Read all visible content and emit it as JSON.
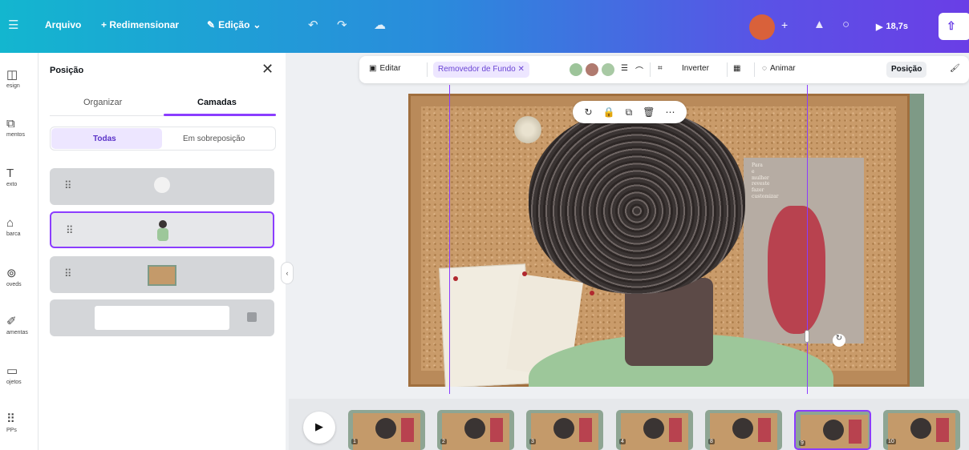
{
  "topbar": {
    "menu_icon": "hamburger-icon",
    "file_label": "Arquivo",
    "resize_label": "+ Redimensionar",
    "edit_label": "Edição",
    "undo_icon": "undo-icon",
    "redo_icon": "redo-icon",
    "cloud_icon": "cloud-save-icon",
    "time_label": "18,7s",
    "share_icon": "share-icon"
  },
  "rail": {
    "items": [
      {
        "icon": "design-icon",
        "label": "esign"
      },
      {
        "icon": "elements-icon",
        "label": "mentos"
      },
      {
        "icon": "text-icon",
        "label": "exto"
      },
      {
        "icon": "brand-icon",
        "label": "barca"
      },
      {
        "icon": "uploads-icon",
        "label": "oveds"
      },
      {
        "icon": "tools-icon",
        "label": "amentas"
      },
      {
        "icon": "projects-icon",
        "label": "ojetos"
      },
      {
        "icon": "apps-icon",
        "label": "PPs"
      }
    ]
  },
  "panel": {
    "title": "Posição",
    "tabs": [
      "Organizar",
      "Camadas"
    ],
    "active_tab": "Camadas",
    "segments": [
      "Todas",
      "Em sobreposição"
    ],
    "active_segment": "Todas",
    "layers": [
      {
        "kind": "flower"
      },
      {
        "kind": "person",
        "selected": true
      },
      {
        "kind": "photo"
      },
      {
        "kind": "background"
      }
    ]
  },
  "context_toolbar": {
    "edit_label": "Editar",
    "bg_remover_label": "Removedor de Fundo",
    "swatch_colors": [
      "#9dc49a",
      "#b07a6f",
      "#a8c9a4"
    ],
    "flip_label": "Inverter",
    "animate_label": "Animar",
    "position_label": "Posição"
  },
  "canvas": {
    "card_text": "Para\ne\nmulher\nreveste\nfazer\ncustomizar"
  },
  "timeline": {
    "play_icon": "play-icon",
    "frames": [
      {
        "number": "1"
      },
      {
        "number": "2"
      },
      {
        "number": "3"
      },
      {
        "number": "4"
      },
      {
        "number": "8"
      },
      {
        "number": "9",
        "active": true
      },
      {
        "number": "10"
      }
    ]
  },
  "colors": {
    "accent": "#8b3dff",
    "topbar_start": "#13b6cf",
    "topbar_end": "#6a3ee6",
    "avatar": "#d9613a"
  }
}
